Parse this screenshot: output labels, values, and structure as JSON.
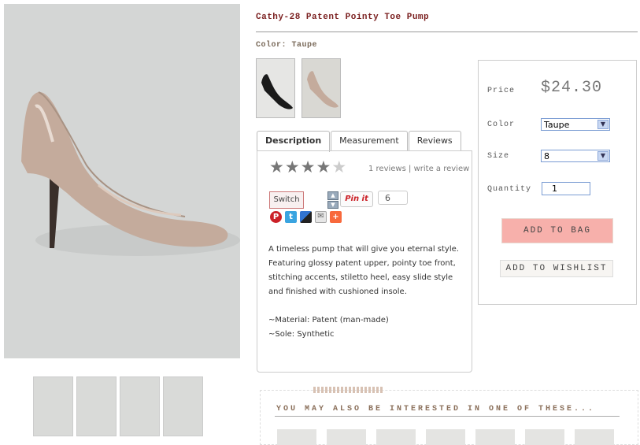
{
  "product": {
    "title": "Cathy-28 Patent Pointy Toe Pump",
    "color_label": "Color: Taupe"
  },
  "tabs": [
    {
      "label": "Description",
      "active": true
    },
    {
      "label": "Measurement",
      "active": false
    },
    {
      "label": "Reviews",
      "active": false
    }
  ],
  "rating": {
    "stars_filled": 4,
    "stars_total": 5,
    "reviews_text": "1 reviews",
    "separator": "|",
    "write_review": "write a review"
  },
  "social": {
    "switch_label": "Switch",
    "pinit_label": "Pin it",
    "pin_count": "6",
    "share_icons": [
      "pinterest-icon",
      "twitter-icon",
      "delicious-icon",
      "email-icon",
      "addthis-icon"
    ]
  },
  "description": {
    "paragraph": "A timeless pump that will give you eternal style. Featuring glossy patent upper, pointy toe front, stitching accents, stiletto heel, easy slide style and finished with cushioned insole.",
    "material": "~Material: Patent (man-made)",
    "sole": "~Sole: Synthetic"
  },
  "purchase": {
    "price_label": "Price",
    "price": "$24.30",
    "color_label": "Color",
    "color_value": "Taupe",
    "size_label": "Size",
    "size_value": "8",
    "quantity_label": "Quantity",
    "quantity_value": "1",
    "add_to_bag": "ADD TO BAG",
    "add_to_wishlist": "ADD TO WISHLIST"
  },
  "also": {
    "title": "YOU MAY ALSO BE INTERESTED IN ONE OF THESE..."
  },
  "colors": {
    "title": "#7a1f1f",
    "add_to_bag_bg": "#f7b0ab",
    "shoe_taupe": "#c4ab9c"
  }
}
